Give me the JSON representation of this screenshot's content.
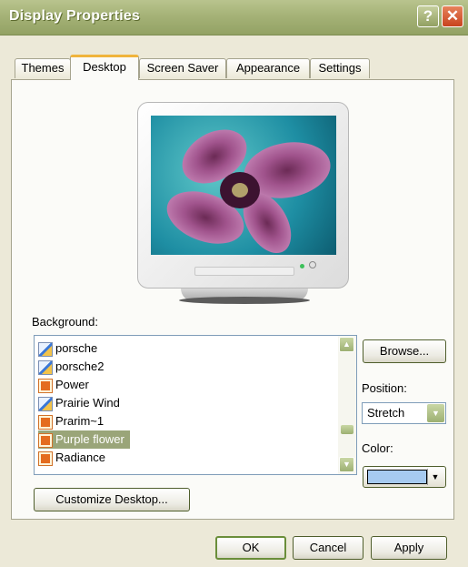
{
  "window": {
    "title": "Display Properties",
    "help_glyph": "?",
    "close_glyph": "✕"
  },
  "tabs": [
    {
      "label": "Themes",
      "active": false
    },
    {
      "label": "Desktop",
      "active": true
    },
    {
      "label": "Screen Saver",
      "active": false
    },
    {
      "label": "Appearance",
      "active": false
    },
    {
      "label": "Settings",
      "active": false
    }
  ],
  "desktop": {
    "background_label": "Background:",
    "backgrounds": [
      {
        "name": "porsche",
        "icon": "image-file-icon"
      },
      {
        "name": "porsche2",
        "icon": "image-file-icon"
      },
      {
        "name": "Power",
        "icon": "html-file-icon"
      },
      {
        "name": "Prairie Wind",
        "icon": "image-file-icon"
      },
      {
        "name": "Prarim~1",
        "icon": "html-file-icon"
      },
      {
        "name": "Purple flower",
        "icon": "html-file-icon",
        "selected": true
      },
      {
        "name": "Radiance",
        "icon": "html-file-icon"
      }
    ],
    "browse_label": "Browse...",
    "position_label": "Position:",
    "position_value": "Stretch",
    "color_label": "Color:",
    "color_value": "#a6caf0",
    "customize_label": "Customize Desktop..."
  },
  "footer": {
    "ok_label": "OK",
    "cancel_label": "Cancel",
    "apply_label": "Apply"
  },
  "colors": {
    "accent_olive": "#9aa579",
    "tab_highlight": "#f0b43c",
    "swatch": "#a6caf0"
  }
}
